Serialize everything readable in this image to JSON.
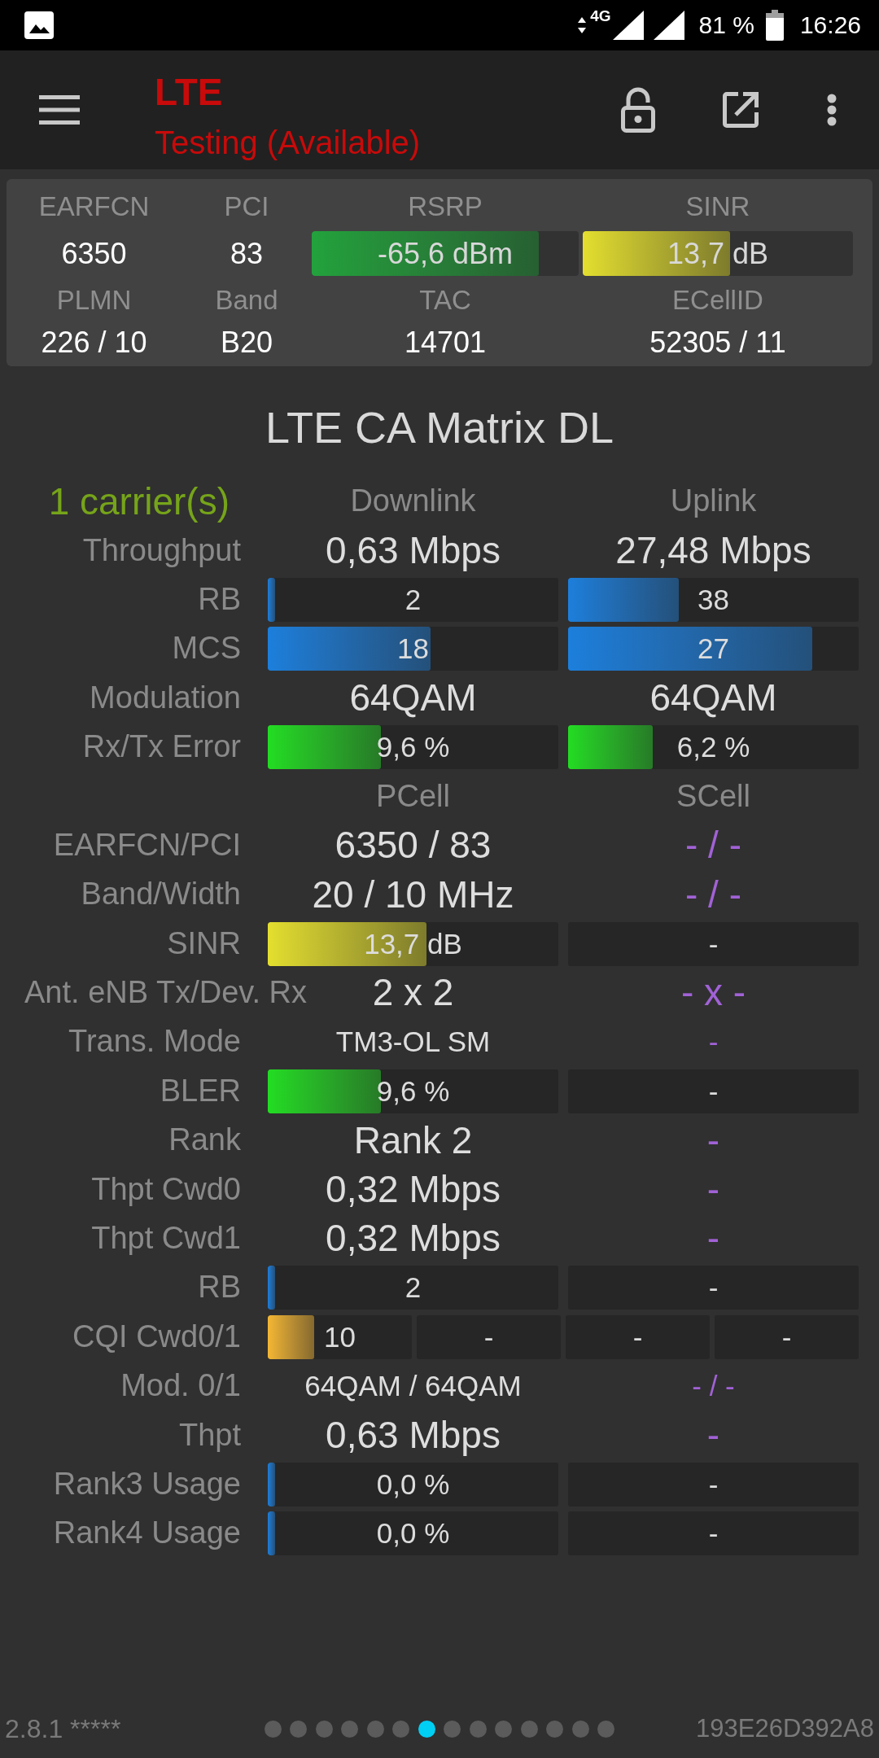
{
  "status_bar": {
    "network_type": "4G",
    "battery": "81 %",
    "time": "16:26"
  },
  "toolbar": {
    "title": "LTE",
    "subtitle": "Testing (Available)"
  },
  "cell_info": {
    "rows": [
      [
        {
          "label": "EARFCN",
          "kind": "text",
          "value": "6350"
        },
        {
          "label": "PCI",
          "kind": "text",
          "value": "83"
        },
        {
          "label": "RSRP",
          "kind": "bar",
          "value": "-65,6 dBm",
          "level": 0.85,
          "color": "#22a23c"
        },
        {
          "label": "SINR",
          "kind": "bar",
          "value": "13,7 dB",
          "level": 0.545,
          "color": "#e4df2e"
        }
      ],
      [
        {
          "label": "PLMN",
          "kind": "text",
          "value": "226 / 10"
        },
        {
          "label": "Band",
          "kind": "text",
          "value": "B20"
        },
        {
          "label": "TAC",
          "kind": "text",
          "value": "14701"
        },
        {
          "label": "ECellID",
          "kind": "text",
          "value": "52305 / 11"
        }
      ]
    ]
  },
  "matrix": {
    "title": "LTE CA Matrix DL",
    "rows": [
      {
        "kind": "header",
        "label": "1 carrier(s)",
        "cells": [
          {
            "value": "Downlink"
          },
          {
            "value": "Uplink"
          }
        ]
      },
      {
        "kind": "value",
        "label": "Throughput",
        "cells": [
          {
            "value": "0,63 Mbps",
            "inactive": false
          },
          {
            "value": "27,48 Mbps",
            "inactive": false
          }
        ]
      },
      {
        "kind": "bar",
        "label": "RB",
        "cells": [
          {
            "value": "2",
            "level": 0.025,
            "color": "#1c7fdc"
          },
          {
            "value": "38",
            "level": 0.38,
            "color": "#1c7fdc"
          }
        ]
      },
      {
        "kind": "bar",
        "label": "MCS",
        "cells": [
          {
            "value": "18",
            "level": 0.56,
            "color": "#1c7fdc"
          },
          {
            "value": "27",
            "level": 0.84,
            "color": "#1c7fdc"
          }
        ]
      },
      {
        "kind": "value",
        "label": "Modulation",
        "cells": [
          {
            "value": "64QAM",
            "inactive": false
          },
          {
            "value": "64QAM",
            "inactive": false
          }
        ]
      },
      {
        "kind": "bar",
        "label": "Rx/Tx Error",
        "cells": [
          {
            "value": "9,6 %",
            "level": 0.39,
            "color": "#22dd22"
          },
          {
            "value": "6,2 %",
            "level": 0.29,
            "color": "#22dd22"
          }
        ]
      },
      {
        "kind": "header",
        "cells": [
          {
            "value": "PCell"
          },
          {
            "value": "SCell"
          }
        ]
      },
      {
        "kind": "value",
        "label": "EARFCN/PCI",
        "cells": [
          {
            "value": "6350 / 83",
            "inactive": false
          },
          {
            "value": "- / -",
            "inactive": true
          }
        ]
      },
      {
        "kind": "value",
        "label": "Band/Width",
        "cells": [
          {
            "value": "20 / 10 MHz",
            "inactive": false
          },
          {
            "value": "- / -",
            "inactive": true
          }
        ]
      },
      {
        "kind": "bar",
        "label": "SINR",
        "cells": [
          {
            "value": "13,7 dB",
            "level": 0.545,
            "color": "#e4df2e"
          },
          {
            "value": "-"
          }
        ]
      },
      {
        "kind": "value",
        "label": "Ant. eNB Tx/Dev. Rx",
        "cells": [
          {
            "value": "2 x 2",
            "inactive": false
          },
          {
            "value": "- x -",
            "inactive": true
          }
        ]
      },
      {
        "kind": "compact",
        "label": "Trans. Mode",
        "cells": [
          {
            "value": "TM3-OL SM",
            "inactive": false
          },
          {
            "value": "-",
            "inactive": true
          }
        ]
      },
      {
        "kind": "bar",
        "label": "BLER",
        "cells": [
          {
            "value": "9,6 %",
            "level": 0.39,
            "color": "#22dd22"
          },
          {
            "value": "-"
          }
        ]
      },
      {
        "kind": "value",
        "label": "Rank",
        "cells": [
          {
            "value": "Rank 2",
            "inactive": false
          },
          {
            "value": "-",
            "inactive": true
          }
        ]
      },
      {
        "kind": "value",
        "label": "Thpt Cwd0",
        "cells": [
          {
            "value": "0,32 Mbps",
            "inactive": false
          },
          {
            "value": "-",
            "inactive": true
          }
        ]
      },
      {
        "kind": "value",
        "label": "Thpt Cwd1",
        "cells": [
          {
            "value": "0,32 Mbps",
            "inactive": false
          },
          {
            "value": "-",
            "inactive": true
          }
        ]
      },
      {
        "kind": "bar",
        "label": "RB",
        "cells": [
          {
            "value": "2",
            "level": 0.025,
            "color": "#1c7fdc"
          },
          {
            "value": "-"
          }
        ]
      },
      {
        "kind": "split",
        "label": "CQI Cwd0/1",
        "cells": [
          {
            "value": "10",
            "level": 0.32,
            "color": "#f4b733"
          },
          {
            "value": "-"
          },
          {
            "value": "-"
          },
          {
            "value": "-"
          }
        ]
      },
      {
        "kind": "compact",
        "label": "Mod. 0/1",
        "cells": [
          {
            "value": "64QAM / 64QAM",
            "inactive": false
          },
          {
            "value": "- / -",
            "inactive": true
          }
        ]
      },
      {
        "kind": "value",
        "label": "Thpt",
        "cells": [
          {
            "value": "0,63 Mbps",
            "inactive": false
          },
          {
            "value": "-",
            "inactive": true
          }
        ]
      },
      {
        "kind": "bar",
        "label": "Rank3 Usage",
        "cells": [
          {
            "value": "0,0 %",
            "level": 0.025,
            "color": "#1c7fdc"
          },
          {
            "value": "-"
          }
        ]
      },
      {
        "kind": "bar",
        "label": "Rank4 Usage",
        "cells": [
          {
            "value": "0,0 %",
            "level": 0.025,
            "color": "#1c7fdc"
          },
          {
            "value": "-"
          }
        ]
      }
    ]
  },
  "footer": {
    "version": "2.8.1 *****",
    "pages": [
      {
        "selected": false
      },
      {
        "selected": false
      },
      {
        "selected": false
      },
      {
        "selected": false
      },
      {
        "selected": false
      },
      {
        "selected": false
      },
      {
        "selected": true
      },
      {
        "selected": false
      },
      {
        "selected": false
      },
      {
        "selected": false
      },
      {
        "selected": false
      },
      {
        "selected": false
      },
      {
        "selected": false
      },
      {
        "selected": false
      }
    ],
    "device_id": "193E26D392A8"
  }
}
